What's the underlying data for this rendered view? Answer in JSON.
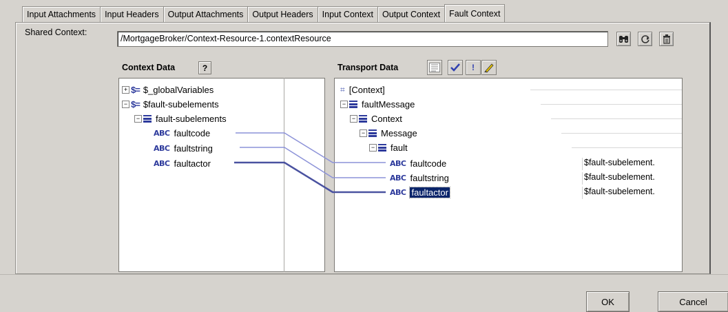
{
  "tabs": [
    "Input Attachments",
    "Input Headers",
    "Output Attachments",
    "Output Headers",
    "Input Context",
    "Output Context",
    "Fault Context"
  ],
  "active_tab": "Fault Context",
  "shared_context": {
    "label": "Shared Context:",
    "value": "/MortgageBroker/Context-Resource-1.contextResource"
  },
  "context_data": {
    "header": "Context Data",
    "help_button": "?",
    "nodes": [
      "$_globalVariables",
      "$fault-subelements",
      "fault-subelements",
      "faultcode",
      "faultstring",
      "faultactor"
    ]
  },
  "transport_data": {
    "header": "Transport Data",
    "nodes": [
      "[Context]",
      "faultMessage",
      "Context",
      "Message",
      "fault",
      "faultcode",
      "faultstring",
      "faultactor"
    ],
    "values": [
      "$fault-subelement.",
      "$fault-subelement.",
      "$fault-subelement."
    ]
  },
  "icons": {
    "dollar": "$=",
    "abc": "ABC",
    "binoculars": "binoculars-icon",
    "refresh": "refresh-icon",
    "trash": "trash-icon"
  },
  "buttons": {
    "ok": "OK",
    "cancel": "Cancel"
  },
  "colors": {
    "selection": "#0a246a",
    "link_line": "#8c92d8",
    "icon_blue": "#2d3a9c"
  }
}
